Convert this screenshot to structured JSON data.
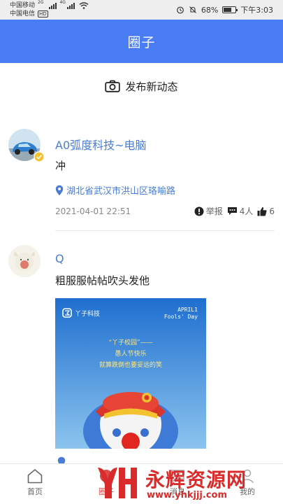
{
  "status_bar": {
    "carrier1": "中国移动",
    "carrier2": "中国电信",
    "hd": "HD",
    "net1": "2G",
    "net2": "4G",
    "battery_text": "68%",
    "battery_level": 0.68,
    "time": "下午3:03",
    "icons": [
      "signal-icon",
      "wifi-icon",
      "alarm-icon",
      "mute-icon",
      "battery-icon"
    ]
  },
  "header": {
    "title": "圈子"
  },
  "publish": {
    "label": "发布新动态",
    "icon": "camera-icon"
  },
  "posts": [
    {
      "username": "A0弧度科技~电脑",
      "content": "冲",
      "location": "湖北省武汉市洪山区珞喻路",
      "timestamp": "2021-04-01 22:51",
      "report_label": "举报",
      "comments_label": "4人",
      "likes_count": "6",
      "verified": true
    },
    {
      "username": "Q",
      "content": "粗服服帖帖吹头发他",
      "image": {
        "logo_text": "丫子科技",
        "april_line1": "APRIL1",
        "april_line2": "Fools' Day",
        "line1": "“丫子校园”——",
        "line2": "愚人节快乐",
        "line3": "就算跌倒也要妥远的笑"
      }
    }
  ],
  "bottom_nav": {
    "items": [
      {
        "label": "首页",
        "icon": "home-icon"
      },
      {
        "label": "圈子",
        "icon": "circle-icon",
        "active": true
      },
      {
        "label": "消息",
        "icon": "message-icon"
      },
      {
        "label": "我的",
        "icon": "profile-icon"
      }
    ]
  },
  "watermark": {
    "text": "永辉资源网",
    "url": "www.yhkjjj.com"
  },
  "colors": {
    "primary": "#4a7cf6",
    "link": "#4a7cd6",
    "watermark": "#d92b2b"
  }
}
